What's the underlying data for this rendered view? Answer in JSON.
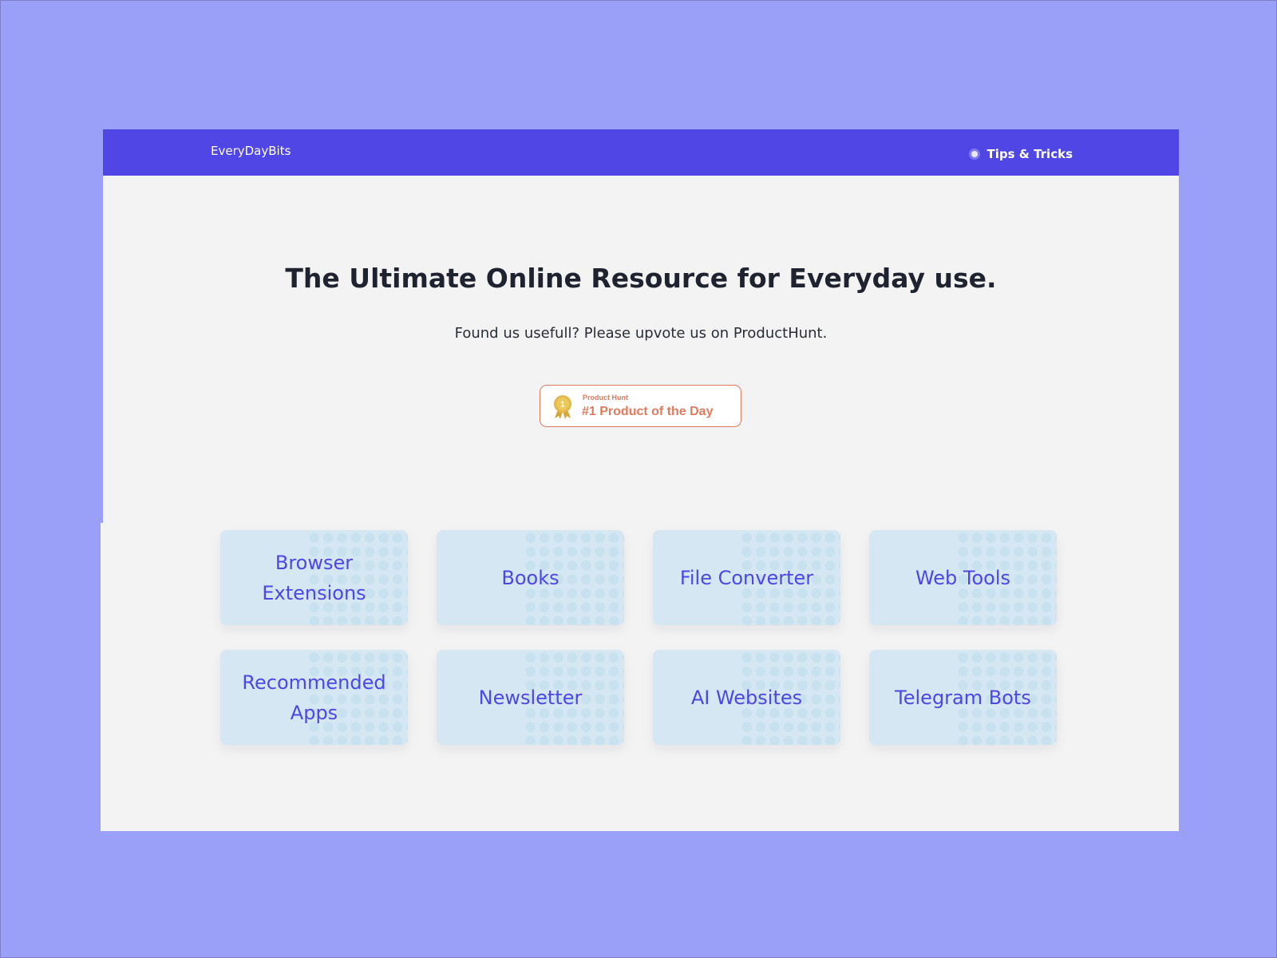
{
  "header": {
    "brand": "EveryDayBits",
    "nav_link": "Tips & Tricks"
  },
  "hero": {
    "title": "The Ultimate Online Resource for Everyday use.",
    "subtitle": "Found us usefull? Please upvote us on ProductHunt."
  },
  "product_hunt_badge": {
    "small_text": "Product Hunt",
    "big_text": "#1 Product of the Day",
    "medal_number": "1"
  },
  "categories": [
    {
      "label": "Browser Extensions"
    },
    {
      "label": "Books"
    },
    {
      "label": "File Converter"
    },
    {
      "label": "Web Tools"
    },
    {
      "label": "Recommended Apps"
    },
    {
      "label": "Newsletter"
    },
    {
      "label": "AI Websites"
    },
    {
      "label": "Telegram Bots"
    }
  ],
  "colors": {
    "page_background": "#9aa0f7",
    "navbar": "#4f46e5",
    "card_background": "#d5e7f3",
    "card_text": "#4f46e5",
    "badge_accent": "#e07a5f",
    "medal_gold": "#e2b94a"
  }
}
